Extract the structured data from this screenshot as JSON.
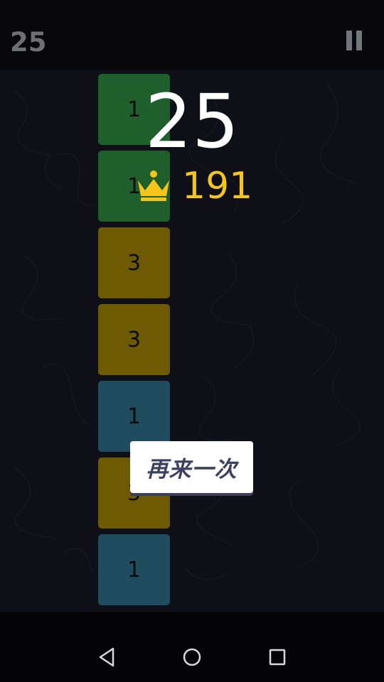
{
  "header": {
    "score": "25",
    "pause_icon": "pause-icon"
  },
  "game": {
    "current_score": "25",
    "best_score": "191",
    "best_icon": "crown-icon",
    "retry_label": "再来一次",
    "tiles": [
      {
        "value": "1",
        "color": "#1f5f2c"
      },
      {
        "value": "1",
        "color": "#1f5f2c"
      },
      {
        "value": "3",
        "color": "#6f5a04"
      },
      {
        "value": "3",
        "color": "#6f5a04"
      },
      {
        "value": "1",
        "color": "#1f4c5f"
      },
      {
        "value": "3",
        "color": "#6f5a04"
      },
      {
        "value": "1",
        "color": "#1f4c5f"
      }
    ],
    "colors": {
      "accent_gold": "#f4c51b",
      "button_text": "#3d4061"
    }
  },
  "navbar": {
    "back_icon": "back-triangle-icon",
    "home_icon": "home-circle-icon",
    "recents_icon": "recents-square-icon"
  }
}
